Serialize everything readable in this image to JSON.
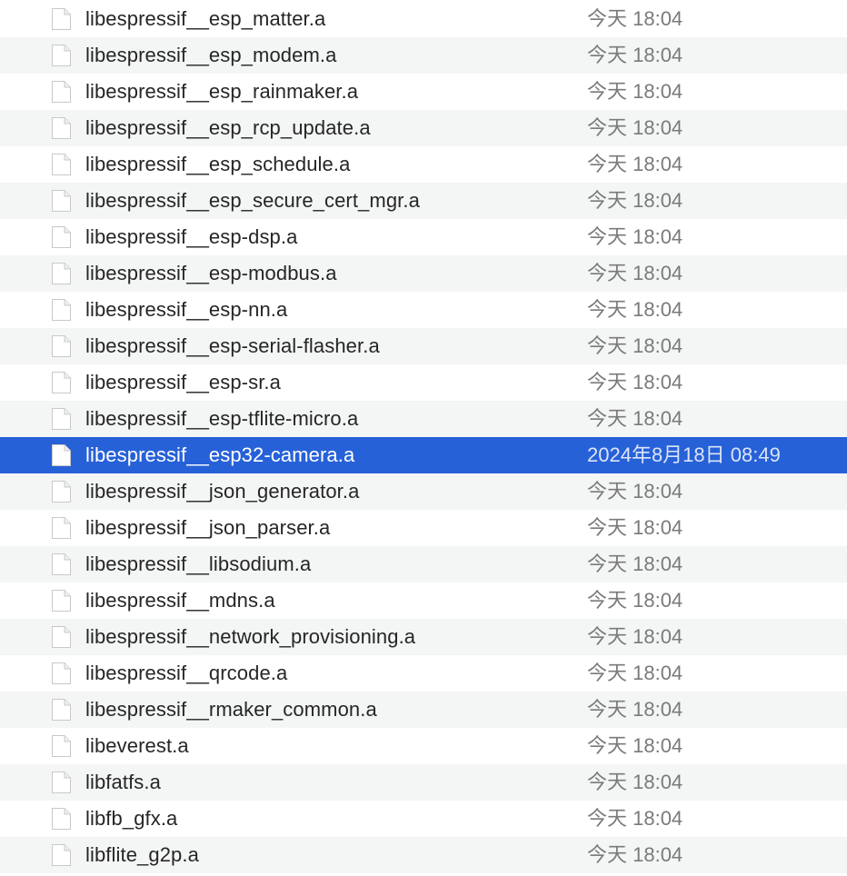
{
  "files": [
    {
      "name": "libespressif__esp_matter.a",
      "date": "今天 18:04",
      "selected": false
    },
    {
      "name": "libespressif__esp_modem.a",
      "date": "今天 18:04",
      "selected": false
    },
    {
      "name": "libespressif__esp_rainmaker.a",
      "date": "今天 18:04",
      "selected": false
    },
    {
      "name": "libespressif__esp_rcp_update.a",
      "date": "今天 18:04",
      "selected": false
    },
    {
      "name": "libespressif__esp_schedule.a",
      "date": "今天 18:04",
      "selected": false
    },
    {
      "name": "libespressif__esp_secure_cert_mgr.a",
      "date": "今天 18:04",
      "selected": false
    },
    {
      "name": "libespressif__esp-dsp.a",
      "date": "今天 18:04",
      "selected": false
    },
    {
      "name": "libespressif__esp-modbus.a",
      "date": "今天 18:04",
      "selected": false
    },
    {
      "name": "libespressif__esp-nn.a",
      "date": "今天 18:04",
      "selected": false
    },
    {
      "name": "libespressif__esp-serial-flasher.a",
      "date": "今天 18:04",
      "selected": false
    },
    {
      "name": "libespressif__esp-sr.a",
      "date": "今天 18:04",
      "selected": false
    },
    {
      "name": "libespressif__esp-tflite-micro.a",
      "date": "今天 18:04",
      "selected": false
    },
    {
      "name": "libespressif__esp32-camera.a",
      "date": "2024年8月18日 08:49",
      "selected": true
    },
    {
      "name": "libespressif__json_generator.a",
      "date": "今天 18:04",
      "selected": false
    },
    {
      "name": "libespressif__json_parser.a",
      "date": "今天 18:04",
      "selected": false
    },
    {
      "name": "libespressif__libsodium.a",
      "date": "今天 18:04",
      "selected": false
    },
    {
      "name": "libespressif__mdns.a",
      "date": "今天 18:04",
      "selected": false
    },
    {
      "name": "libespressif__network_provisioning.a",
      "date": "今天 18:04",
      "selected": false
    },
    {
      "name": "libespressif__qrcode.a",
      "date": "今天 18:04",
      "selected": false
    },
    {
      "name": "libespressif__rmaker_common.a",
      "date": "今天 18:04",
      "selected": false
    },
    {
      "name": "libeverest.a",
      "date": "今天 18:04",
      "selected": false
    },
    {
      "name": "libfatfs.a",
      "date": "今天 18:04",
      "selected": false
    },
    {
      "name": "libfb_gfx.a",
      "date": "今天 18:04",
      "selected": false
    },
    {
      "name": "libflite_g2p.a",
      "date": "今天 18:04",
      "selected": false
    }
  ],
  "icon": "document-icon",
  "colors": {
    "selection": "#2761d8",
    "stripe": "#f4f5f5",
    "name_text": "#262626",
    "date_text": "#7a7a7a"
  }
}
